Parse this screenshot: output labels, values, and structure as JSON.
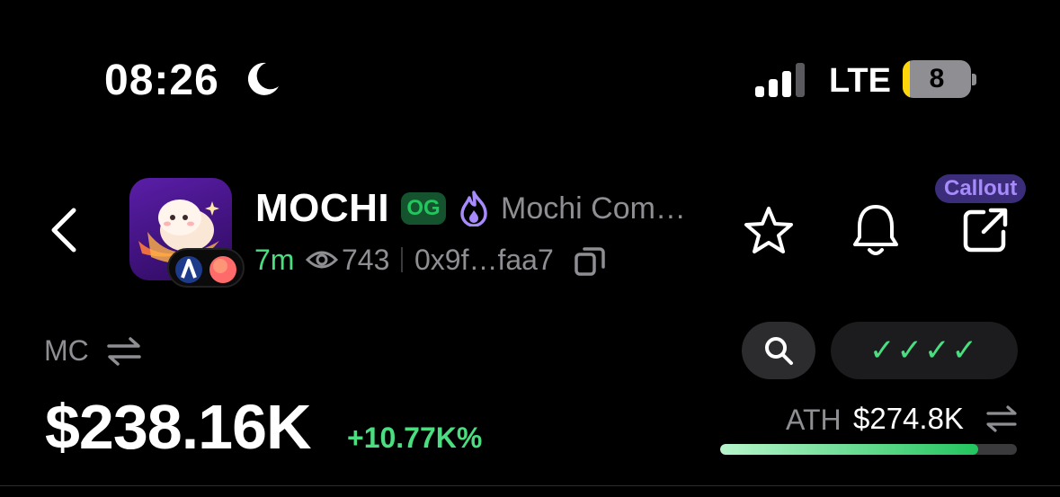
{
  "status_bar": {
    "time": "08:26",
    "network": "LTE",
    "battery_level": "8",
    "icons": [
      "moon-icon",
      "signal-icon",
      "battery-icon"
    ]
  },
  "header": {
    "token_symbol": "MOCHI",
    "og_badge": "OG",
    "token_name": "Mochi Com…",
    "age": "7m",
    "views": "743",
    "address": "0x9f…faa7",
    "callout_label": "Callout",
    "icons": [
      "back-icon",
      "flame-icon",
      "eye-icon",
      "copy-icon",
      "star-icon",
      "bell-icon",
      "share-icon"
    ]
  },
  "market": {
    "mc_label": "MC",
    "mc_value": "$238.16K",
    "mc_change": "+10.77K%",
    "checks": "✓✓✓✓",
    "ath_label": "ATH",
    "ath_value": "$274.8K",
    "ath_progress_percent": 87
  },
  "colors": {
    "accent_green": "#4ade80",
    "muted_text": "#8e8e93",
    "callout_purple": "#a78bfa",
    "background": "#000000"
  }
}
